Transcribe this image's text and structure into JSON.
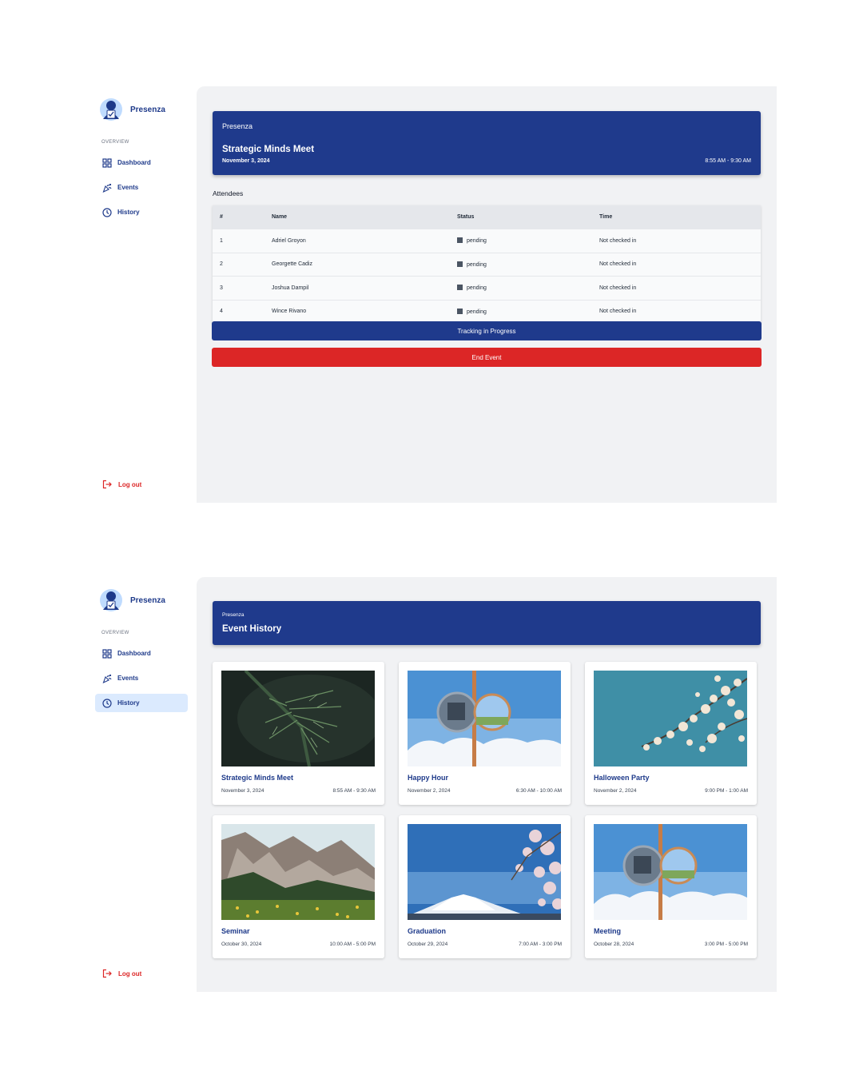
{
  "app": {
    "name": "Presenza"
  },
  "sidebar": {
    "section": "OVERVIEW",
    "items": [
      {
        "label": "Dashboard",
        "icon": "grid-icon"
      },
      {
        "label": "Events",
        "icon": "party-icon"
      },
      {
        "label": "History",
        "icon": "clock-icon"
      }
    ],
    "logout": "Log out"
  },
  "event_screen": {
    "header_brand": "Presenza",
    "title": "Strategic Minds Meet",
    "date": "November 3, 2024",
    "time": "8:55 AM - 9:30 AM",
    "attendees_label": "Attendees",
    "columns": [
      "#",
      "Name",
      "Status",
      "Time"
    ],
    "rows": [
      {
        "num": "1",
        "name": "Adriel Groyon",
        "status": "pending",
        "time": "Not checked in"
      },
      {
        "num": "2",
        "name": "Georgette Cadiz",
        "status": "pending",
        "time": "Not checked in"
      },
      {
        "num": "3",
        "name": "Joshua Dampil",
        "status": "pending",
        "time": "Not checked in"
      },
      {
        "num": "4",
        "name": "Wince Rivano",
        "status": "pending",
        "time": "Not checked in"
      }
    ],
    "tracking_button": "Tracking in Progress",
    "end_button": "End Event"
  },
  "history_screen": {
    "header_brand": "Presenza",
    "title": "Event History",
    "active_nav": "History",
    "cards": [
      {
        "title": "Strategic Minds Meet",
        "date": "November 3, 2024",
        "time": "8:55 AM - 9:30 AM",
        "image": "pine-branch"
      },
      {
        "title": "Happy Hour",
        "date": "November 2, 2024",
        "time": "6:30 AM - 10:00 AM",
        "image": "mirror-sky"
      },
      {
        "title": "Halloween Party",
        "date": "November 2, 2024",
        "time": "9:00 PM - 1:00 AM",
        "image": "blossom-sky"
      },
      {
        "title": "Seminar",
        "date": "October 30, 2024",
        "time": "10:00 AM - 5:00 PM",
        "image": "mountain-meadow"
      },
      {
        "title": "Graduation",
        "date": "October 29, 2024",
        "time": "7:00 AM - 3:00 PM",
        "image": "fuji-blossom"
      },
      {
        "title": "Meeting",
        "date": "October 28, 2024",
        "time": "3:00 PM - 5:00 PM",
        "image": "mirror-sky"
      }
    ]
  },
  "colors": {
    "primary": "#1f3a8c",
    "danger": "#dc2626",
    "background": "#f1f2f4",
    "active_nav": "#dbeafe"
  }
}
